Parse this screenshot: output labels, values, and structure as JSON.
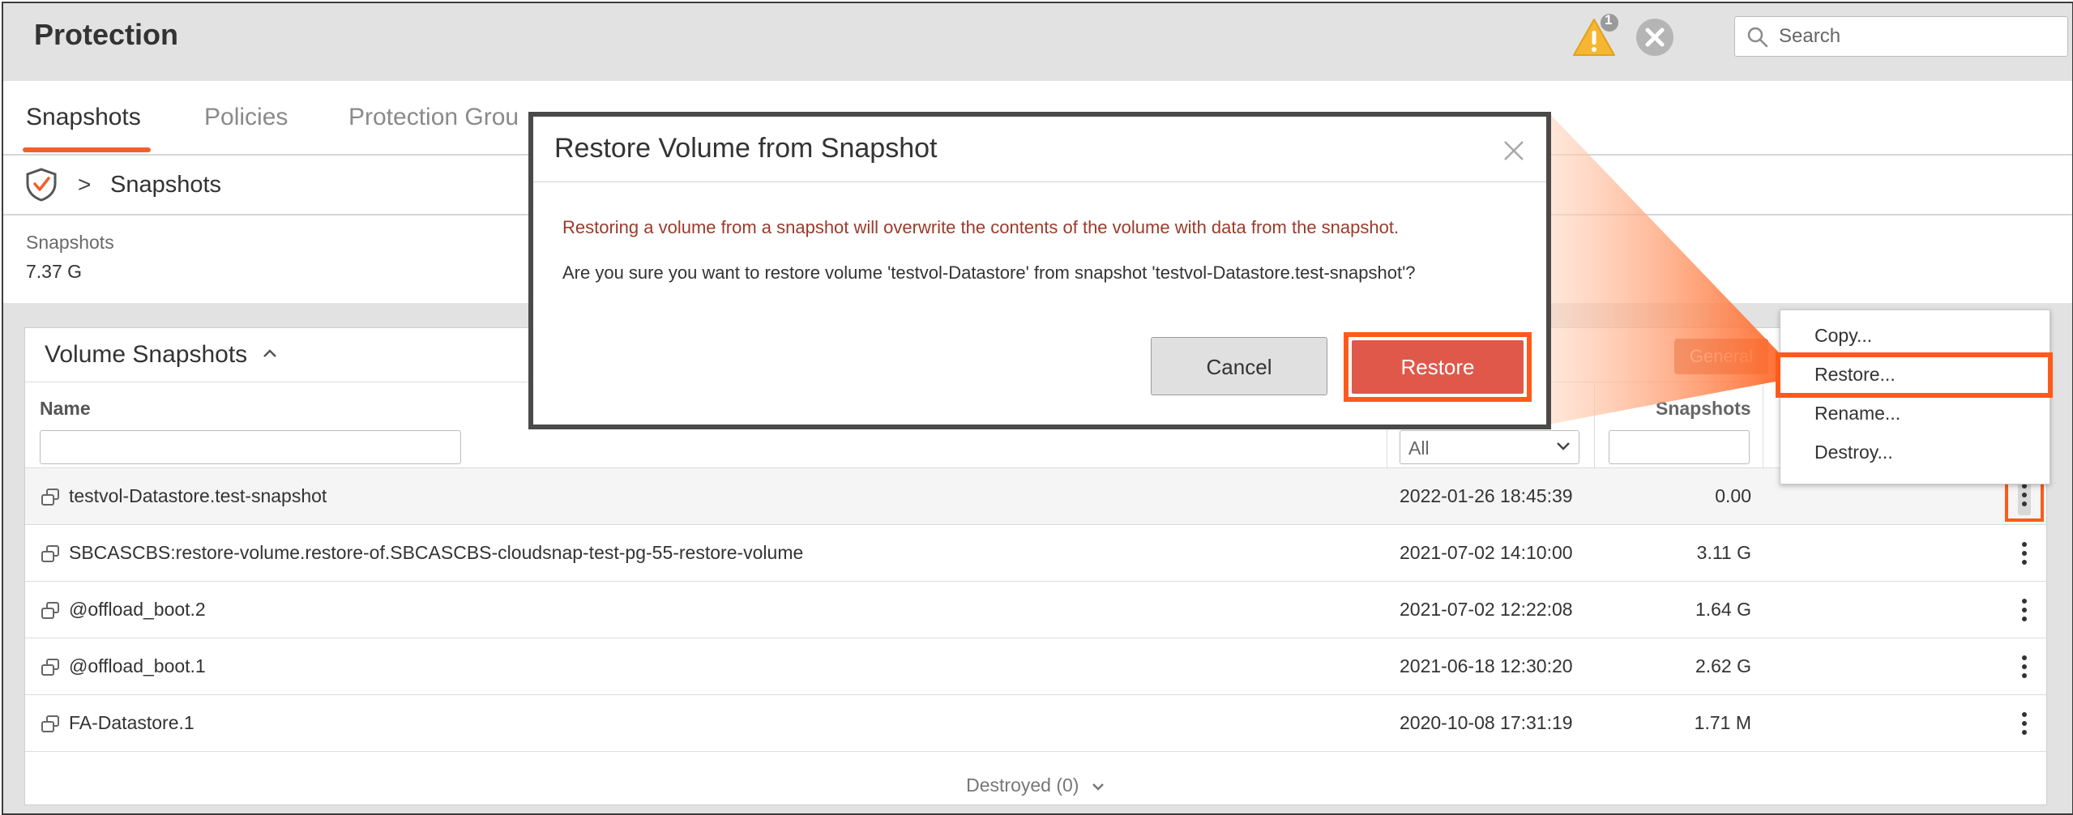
{
  "header": {
    "title": "Protection",
    "alert_count": "1",
    "search": {
      "placeholder": "Search"
    }
  },
  "tabs": [
    {
      "label": "Snapshots",
      "active": true
    },
    {
      "label": "Policies",
      "active": false
    },
    {
      "label": "Protection Grou",
      "active": false
    }
  ],
  "breadcrumb": {
    "separator": ">",
    "current": "Snapshots"
  },
  "summary": {
    "label": "Snapshots",
    "value": "7.37 G"
  },
  "panel": {
    "title": "Volume Snapshots",
    "general_button": "General",
    "columns": {
      "name": "Name",
      "snapshots": "Snapshots"
    },
    "created_filter": "All",
    "rows": [
      {
        "name": "testvol-Datastore.test-snapshot",
        "created": "2022-01-26 18:45:39",
        "size": "0.00"
      },
      {
        "name": "SBCASCBS:restore-volume.restore-of.SBCASCBS-cloudsnap-test-pg-55-restore-volume",
        "created": "2021-07-02 14:10:00",
        "size": "3.11 G"
      },
      {
        "name": "@offload_boot.2",
        "created": "2021-07-02 12:22:08",
        "size": "1.64 G"
      },
      {
        "name": "@offload_boot.1",
        "created": "2021-06-18 12:30:20",
        "size": "2.62 G"
      },
      {
        "name": "FA-Datastore.1",
        "created": "2020-10-08 17:31:19",
        "size": "1.71 M"
      }
    ],
    "destroyed": "Destroyed (0)"
  },
  "context_menu": {
    "items": [
      "Copy...",
      "Restore...",
      "Rename...",
      "Destroy..."
    ],
    "highlighted": "Restore..."
  },
  "modal": {
    "title": "Restore Volume from Snapshot",
    "warning": "Restoring a volume from a snapshot will overwrite the contents of the volume with data from the snapshot.",
    "question": "Are you sure you want to restore volume 'testvol-Datastore' from snapshot 'testvol-Datastore.test-snapshot'?",
    "cancel_label": "Cancel",
    "restore_label": "Restore"
  },
  "colors": {
    "accent": "#f0602a",
    "highlight": "#ff5a1a",
    "restore_button": "#e0584a",
    "warning_text": "#9a3b2a"
  }
}
